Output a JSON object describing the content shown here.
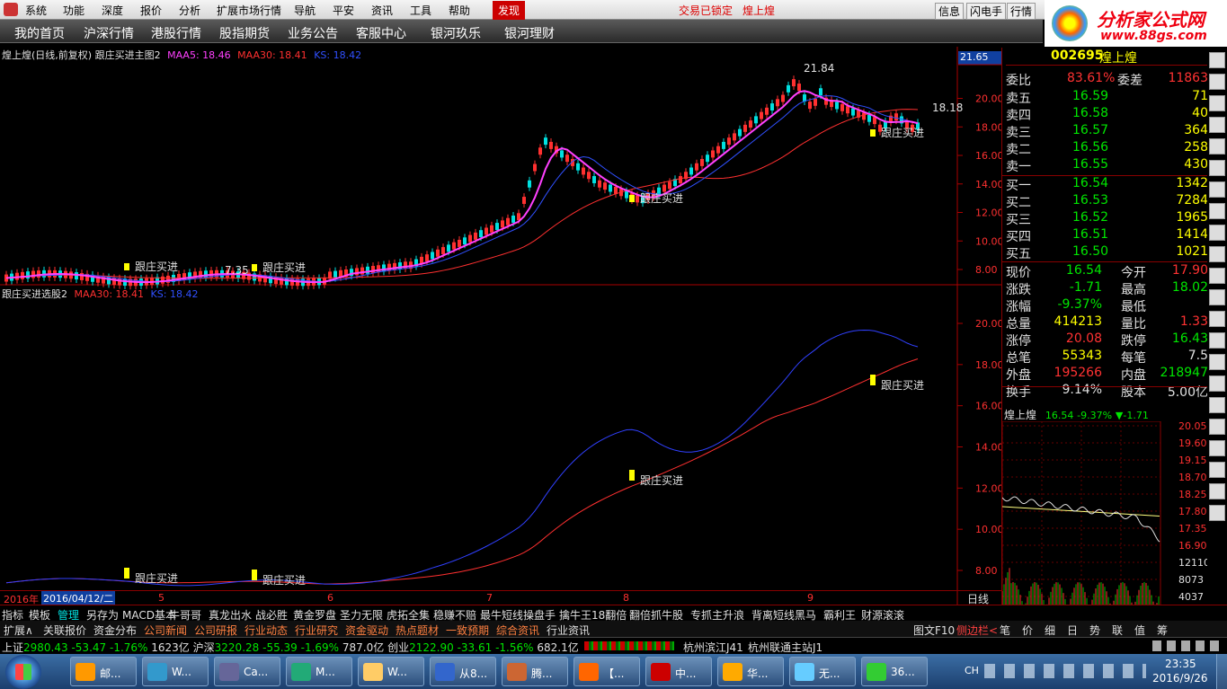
{
  "menubar": {
    "items": [
      "系统",
      "功能",
      "深度",
      "报价",
      "分析",
      "扩展市场行情",
      "导航",
      "平安",
      "资讯",
      "工具",
      "帮助",
      "发现"
    ],
    "center_status": "交易已锁定",
    "center_stock": "煌上煌",
    "right_buttons": [
      "信息",
      "闪电手",
      "行情"
    ]
  },
  "logo": {
    "text": "分析家公式网",
    "url_text": "www.88gs.com"
  },
  "navbar": {
    "items": [
      "我的首页",
      "沪深行情",
      "港股行情",
      "股指期货",
      "业务公告",
      "客服中心",
      "银河玖乐",
      "银河理财"
    ]
  },
  "main_chart": {
    "title": "煌上煌(日线,前复权)",
    "indicator": "跟庄买进主图2",
    "maa5_label": "MAA5: 18.46",
    "maa30_label": "MAA30: 18.41",
    "ks_label": "KS: 18.42",
    "price_tag": "21.65",
    "high_label": "21.84",
    "low_label": "7.35",
    "last_label": "18.18",
    "y_ticks": [
      "20.00",
      "18.00",
      "16.00",
      "14.00",
      "12.00",
      "10.00",
      "8.00"
    ],
    "signal_text": "跟庄买进"
  },
  "sub_chart": {
    "title": "跟庄买进选股2",
    "maa30_label": "MAA30: 18.41",
    "ks_label": "KS: 18.42",
    "y_ticks": [
      "20.00",
      "18.00",
      "16.00",
      "14.00",
      "12.00",
      "10.00",
      "8.00"
    ],
    "signal_text": "跟庄买进"
  },
  "date_axis": {
    "year": "2016年",
    "cursor_date": "2016/04/12/二",
    "months": [
      "5",
      "6",
      "7",
      "8",
      "9"
    ],
    "period": "日线"
  },
  "quote": {
    "code": "002695",
    "name": "煌上煌",
    "weibi_label": "委比",
    "weibi": "83.61%",
    "weicha_label": "委差",
    "weicha": "11863",
    "asks": [
      {
        "label": "卖五",
        "price": "16.59",
        "vol": "71"
      },
      {
        "label": "卖四",
        "price": "16.58",
        "vol": "40"
      },
      {
        "label": "卖三",
        "price": "16.57",
        "vol": "364"
      },
      {
        "label": "卖二",
        "price": "16.56",
        "vol": "258"
      },
      {
        "label": "卖一",
        "price": "16.55",
        "vol": "430"
      }
    ],
    "bids": [
      {
        "label": "买一",
        "price": "16.54",
        "vol": "1342"
      },
      {
        "label": "买二",
        "price": "16.53",
        "vol": "7284"
      },
      {
        "label": "买三",
        "price": "16.52",
        "vol": "1965"
      },
      {
        "label": "买四",
        "price": "16.51",
        "vol": "1414"
      },
      {
        "label": "买五",
        "price": "16.50",
        "vol": "1021"
      }
    ],
    "stats": [
      {
        "l1": "现价",
        "v1": "16.54",
        "l2": "今开",
        "v2": "17.90"
      },
      {
        "l1": "涨跌",
        "v1": "-1.71",
        "l2": "最高",
        "v2": "18.02"
      },
      {
        "l1": "涨幅",
        "v1": "-9.37%",
        "l2": "最低",
        "v2": ""
      },
      {
        "l1": "总量",
        "v1": "414213",
        "l2": "量比",
        "v2": "1.33"
      },
      {
        "l1": "涨停",
        "v1": "20.08",
        "l2": "跌停",
        "v2": "16.43"
      },
      {
        "l1": "总笔",
        "v1": "55343",
        "l2": "每笔",
        "v2": "7.5"
      },
      {
        "l1": "外盘",
        "v1": "195266",
        "l2": "内盘",
        "v2": "218947"
      },
      {
        "l1": "换手",
        "v1": "9.14%",
        "l2": "股本",
        "v2": "5.00亿"
      }
    ],
    "mini_title": "煌上煌",
    "mini_price": "16.54",
    "mini_change": "-9.37%",
    "mini_delta": "▼-1.71",
    "mini_ticks": [
      "20.05",
      "19.60",
      "19.15",
      "18.70",
      "18.25",
      "17.80",
      "17.35",
      "16.90",
      "12110",
      "8073",
      "4037"
    ]
  },
  "toolbar": {
    "items": [
      "指标",
      "模板",
      "管理",
      "另存为",
      "MACD基本",
      "牛哥哥",
      "真龙出水",
      "战必胜",
      "黄金罗盘",
      "圣力无限",
      "虎拓全集",
      "稳赚不赔",
      "最牛短线操盘手",
      "擒牛王18翻倍",
      "翻倍抓牛股",
      "专抓主升浪",
      "背离短线黑马",
      "霸利王",
      "财源滚滚"
    ],
    "row2": [
      "扩展∧",
      "关联报价",
      "资金分布",
      "公司新闻",
      "公司研报",
      "行业动态",
      "行业研究",
      "资金驱动",
      "热点题材",
      "一致预期",
      "综合资讯",
      "行业资讯"
    ],
    "right2": [
      "图文F10",
      "侧边栏<",
      "笔",
      "价",
      "细",
      "日",
      "势",
      "联",
      "值",
      "筹"
    ]
  },
  "status": {
    "sh_label": "上证",
    "sh": "2980.43",
    "sh_chg": "-53.47",
    "sh_pct": "-1.76%",
    "sh_amt": "1623亿",
    "hs_label": "沪深",
    "hs": "3220.28",
    "hs_chg": "-55.39",
    "hs_pct": "-1.69%",
    "hs_amt": "787.0亿",
    "cy_label": "创业",
    "cy": "2122.90",
    "cy_chg": "-33.61",
    "cy_pct": "-1.56%",
    "cy_amt": "682.1亿",
    "server1": "杭州滨江J41",
    "server2": "杭州联通主站J1"
  },
  "taskbar": {
    "items": [
      "邮...",
      "W...",
      "Ca...",
      "M...",
      "W...",
      "从8...",
      "腾...",
      "【...",
      "中...",
      "华...",
      "无...",
      "36..."
    ],
    "lang": "CH",
    "time": "23:35",
    "date": "2016/9/26"
  }
}
